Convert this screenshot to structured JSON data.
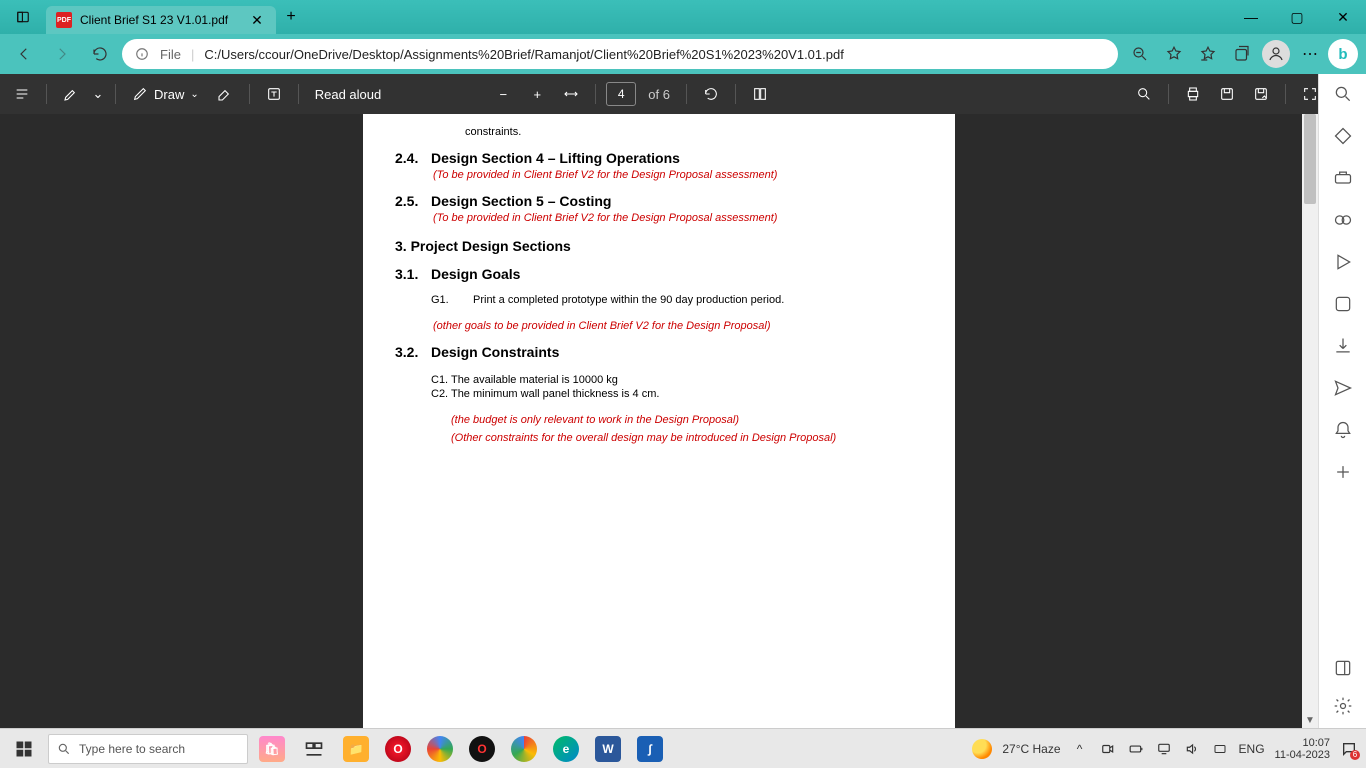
{
  "window": {
    "tab_title": "Client Brief S1 23 V1.01.pdf",
    "url_label": "File",
    "url_path": "C:/Users/ccour/OneDrive/Desktop/Assignments%20Brief/Ramanjot/Client%20Brief%20S1%2023%20V1.01.pdf"
  },
  "pdf_toolbar": {
    "draw_label": "Draw",
    "read_aloud_label": "Read aloud",
    "page_current": "4",
    "page_total": "of 6"
  },
  "document": {
    "frag_top": "constraints.",
    "s24_num": "2.4.",
    "s24_title": "Design Section 4 – Lifting Operations",
    "s24_note": "(To be provided in Client Brief V2 for the Design Proposal assessment)",
    "s25_num": "2.5.",
    "s25_title": "Design Section 5 – Costing",
    "s25_note": "(To be provided in Client Brief V2 for the Design Proposal assessment)",
    "s3_title": "3.  Project Design Sections",
    "s31_num": "3.1.",
    "s31_title": "Design Goals",
    "g1_id": "G1.",
    "g1_text": "Print a completed prototype within the 90 day production period.",
    "goals_note": "(other goals to be provided in Client Brief V2 for the Design Proposal)",
    "s32_num": "3.2.",
    "s32_title": "Design Constraints",
    "c1": "C1. The available material is 10000 kg",
    "c2": "C2. The minimum wall panel thickness is 4 cm.",
    "budget_note": "(the budget is only relevant to work in the Design Proposal)",
    "other_constraints_note": "(Other constraints for the overall design may be introduced in Design Proposal)"
  },
  "taskbar": {
    "search_placeholder": "Type here to search",
    "weather": "27°C  Haze",
    "lang": "ENG",
    "time": "10:07",
    "date": "11-04-2023"
  }
}
